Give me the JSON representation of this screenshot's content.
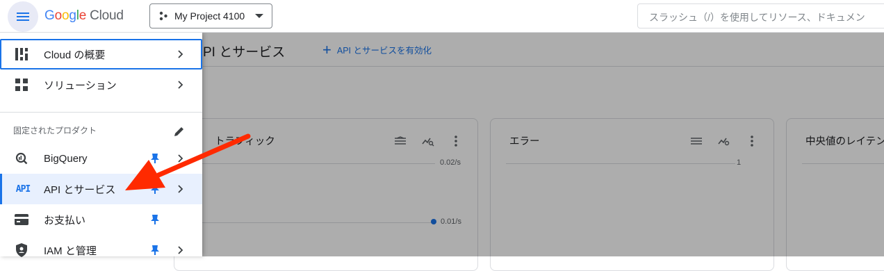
{
  "header": {
    "logo_google": "Google",
    "logo_cloud": "Cloud",
    "project_name": "My Project 4100",
    "search_placeholder": "スラッシュ（/）を使用してリソース、ドキュメン"
  },
  "main": {
    "page_title": "PI とサービス",
    "enable_api_label": "API とサービスを有効化",
    "cards": [
      {
        "title": "トラフィック",
        "ticks": [
          "0.02/s",
          "0.01/s"
        ]
      },
      {
        "title": "エラー",
        "ticks": [
          "1"
        ]
      },
      {
        "title": "中央値のレイテン"
      }
    ]
  },
  "sidenav": {
    "items_top": [
      {
        "label": "Cloud の概要",
        "icon": "dashboard-icon"
      },
      {
        "label": "ソリューション",
        "icon": "grid-icon"
      }
    ],
    "pinned_heading": "固定されたプロダクト",
    "pinned": [
      {
        "label": "BigQuery",
        "icon": "bigquery-icon",
        "pinned": true
      },
      {
        "label": "API とサービス",
        "icon": "api-icon",
        "badge": "API",
        "pinned": true
      },
      {
        "label": "お支払い",
        "icon": "billing-icon",
        "pinned": true
      },
      {
        "label": "IAM と管理",
        "icon": "iam-shield-icon",
        "pinned": true
      }
    ]
  },
  "colors": {
    "accent": "#1a73e8",
    "pin": "#1a73e8",
    "annotation_arrow": "#ff2a00",
    "overlay": "rgba(0,0,0,0.32)"
  }
}
